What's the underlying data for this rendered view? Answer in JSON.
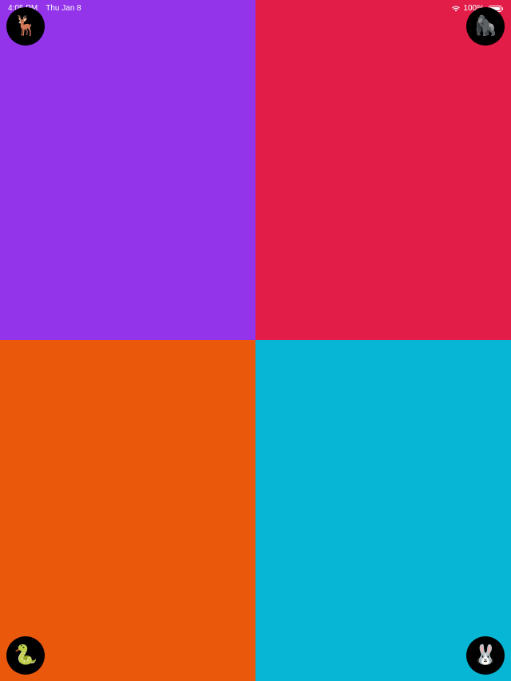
{
  "status_bar": {
    "time": "4:05 PM",
    "date": "Thu Jan 8",
    "battery": "100%",
    "battery_level": 1.0
  },
  "quadrants": [
    {
      "name": "top-left",
      "color": "#9333EA",
      "animal_icon": "deer-icon",
      "animal_emoji": "🦌"
    },
    {
      "name": "top-right",
      "color": "#E11D48",
      "animal_icon": "gorilla-icon",
      "animal_emoji": "🦍"
    },
    {
      "name": "bottom-left",
      "color": "#EA580C",
      "animal_icon": "snake-icon",
      "animal_emoji": "🐍"
    },
    {
      "name": "bottom-right",
      "color": "#06B6D4",
      "animal_icon": "rabbit-icon",
      "animal_emoji": "🐰"
    }
  ]
}
